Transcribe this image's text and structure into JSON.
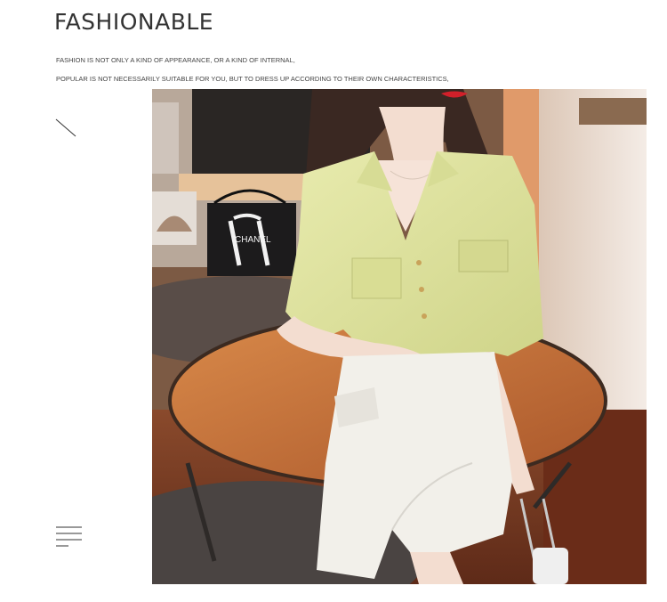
{
  "header": {
    "title": "FASHIONABLE",
    "line1": "FASHION IS NOT ONLY A KIND OF APPEARANCE, OR A KIND OF INTERNAL,",
    "line2": "POPULAR IS NOT NECESSARILY SUITABLE FOR YOU, BUT TO DRESS UP ACCORDING TO THEIR OWN CHARACTERISTICS,"
  },
  "decor": {
    "slash_icon": "diagonal-line-icon",
    "menu_icon": "menu-lines-icon"
  },
  "photo": {
    "bag_text": "CHANEL",
    "colors": {
      "blouse": "#dfe39a",
      "skirt": "#f2f0ea",
      "table": "#c8743a",
      "floor": "#7a3a22",
      "wall": "#f0e8e2"
    }
  }
}
